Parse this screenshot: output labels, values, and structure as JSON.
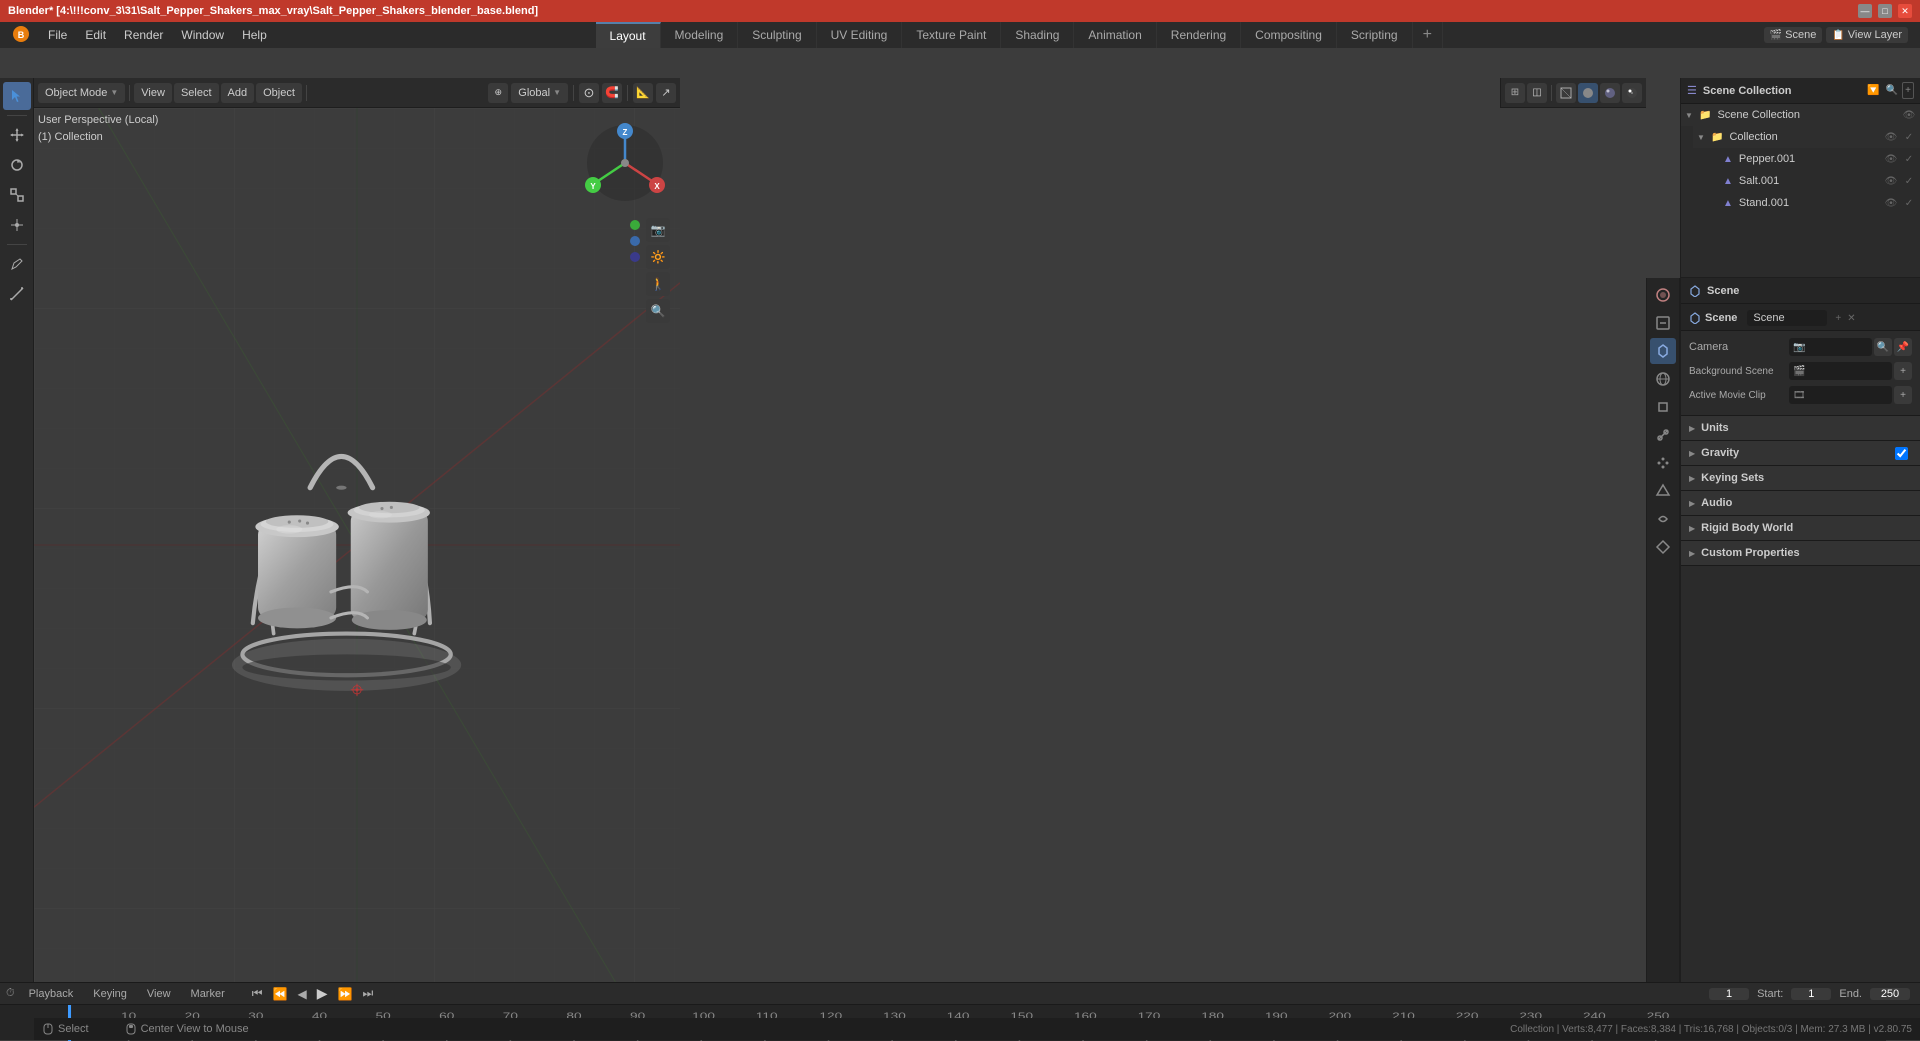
{
  "titlebar": {
    "title": "Blender* [4:\\!!!conv_3\\31\\Salt_Pepper_Shakers_max_vray\\Salt_Pepper_Shakers_blender_base.blend]",
    "minimize": "—",
    "maximize": "□",
    "close": "✕"
  },
  "menubar": {
    "items": [
      "Blender®",
      "File",
      "Edit",
      "Render",
      "Window",
      "Help"
    ]
  },
  "tabs": {
    "items": [
      "Layout",
      "Modeling",
      "Sculpting",
      "UV Editing",
      "Texture Paint",
      "Shading",
      "Animation",
      "Rendering",
      "Compositing",
      "Scripting",
      "+"
    ],
    "active": "Layout"
  },
  "top_right": {
    "scene_label": "Scene",
    "view_layer_label": "View Layer"
  },
  "viewport": {
    "mode_label": "Object Mode",
    "view_label": "View",
    "select_label": "Select",
    "add_label": "Add",
    "object_label": "Object",
    "perspective_label": "User Perspective (Local)",
    "collection_label": "(1) Collection",
    "global_label": "Global",
    "cursor_label": "· ×",
    "stats": "Collection | Verts:8,477 | Faces:8,384 | Tris:16,768 | Objects:0/3 | Mem: 27.3 MB | v2.80.75"
  },
  "outliner": {
    "title": "Scene Collection",
    "items": [
      {
        "name": "Collection",
        "indent": 0,
        "type": "collection",
        "expanded": true
      },
      {
        "name": "Pepper.001",
        "indent": 1,
        "type": "object"
      },
      {
        "name": "Salt.001",
        "indent": 1,
        "type": "object"
      },
      {
        "name": "Stand.001",
        "indent": 1,
        "type": "object"
      }
    ]
  },
  "properties": {
    "header": "Scene",
    "scene_name": "Scene",
    "camera_label": "Camera",
    "camera_value": "",
    "background_scene_label": "Background Scene",
    "active_movie_clip_label": "Active Movie Clip",
    "sections": [
      {
        "id": "units",
        "label": "Units",
        "expanded": false
      },
      {
        "id": "gravity",
        "label": "Gravity",
        "expanded": false,
        "has_checkbox": true,
        "checked": true
      },
      {
        "id": "keying_sets",
        "label": "Keying Sets",
        "expanded": false
      },
      {
        "id": "audio",
        "label": "Audio",
        "expanded": false
      },
      {
        "id": "rigid_body_world",
        "label": "Rigid Body World",
        "expanded": false
      },
      {
        "id": "custom_properties",
        "label": "Custom Properties",
        "expanded": false
      }
    ]
  },
  "timeline": {
    "items": [
      "Playback",
      "Keying",
      "View",
      "Marker"
    ],
    "frame_current": "1",
    "frame_start_label": "Start:",
    "frame_start": "1",
    "frame_end_label": "End.",
    "frame_end": "250",
    "frame_markers": [
      1,
      10,
      20,
      30,
      40,
      50,
      60,
      70,
      80,
      90,
      100,
      110,
      120,
      130,
      140,
      150,
      160,
      170,
      180,
      190,
      200,
      210,
      220,
      230,
      240,
      250
    ]
  },
  "statusbar": {
    "select_label": "Select",
    "center_label": "Center View to Mouse",
    "stats": "Collection | Verts:8,477 | Faces:8,384 | Tris:16,768 | Objects:0/3 | Mem: 27.3 MB | v2.80.75"
  }
}
